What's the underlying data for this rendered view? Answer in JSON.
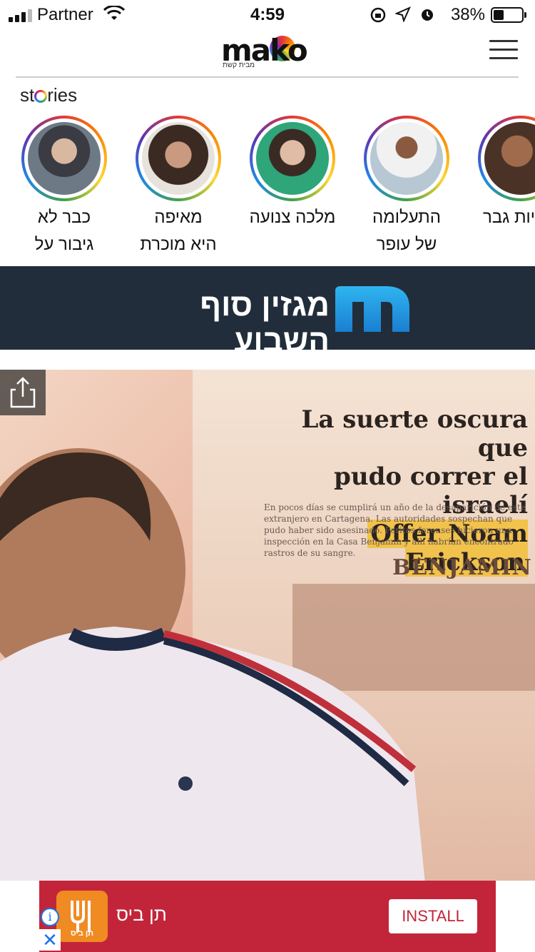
{
  "status_bar": {
    "carrier": "Partner",
    "time": "4:59",
    "battery": "38%",
    "battery_level": 0.38
  },
  "header": {
    "logo_text": "mako",
    "logo_sub": "מבית קשת",
    "menu_icon": "hamburger-icon"
  },
  "stories": {
    "label_before": "st",
    "label_after": "ries",
    "items": [
      {
        "line1": "כבר לא",
        "line2": "גיבור על"
      },
      {
        "line1": "מאיפה",
        "line2": "היא מוכרת"
      },
      {
        "line1": "מלכה צנועה",
        "line2": ""
      },
      {
        "line1": "התעלומה",
        "line2": "של עופר"
      },
      {
        "line1": "יות גבר",
        "line2": ""
      }
    ]
  },
  "magazine": {
    "title": "מגזין סוף השבוע"
  },
  "hero": {
    "headline_line1": "La suerte oscura que",
    "headline_line2": "pudo correr el israelí",
    "headline_line3": "Offer Noam Erickson",
    "body_text": "En pocos días se cumplirá un año de la desaparición de este extranjero en Cartagena. Las autoridades sospechan que pudo haber sido asesinado. Peritos forenses hicieron una inspección en la Casa Benjamin y allí habrían encontrado rastros de su sangre.",
    "sign_text": "BENJAMIN",
    "share_icon": "share-icon"
  },
  "ad": {
    "app_name": "תן ביס",
    "icon_label": "תן ביס",
    "install_label": "INSTALL",
    "info_label": "i",
    "close_label": "✕"
  }
}
